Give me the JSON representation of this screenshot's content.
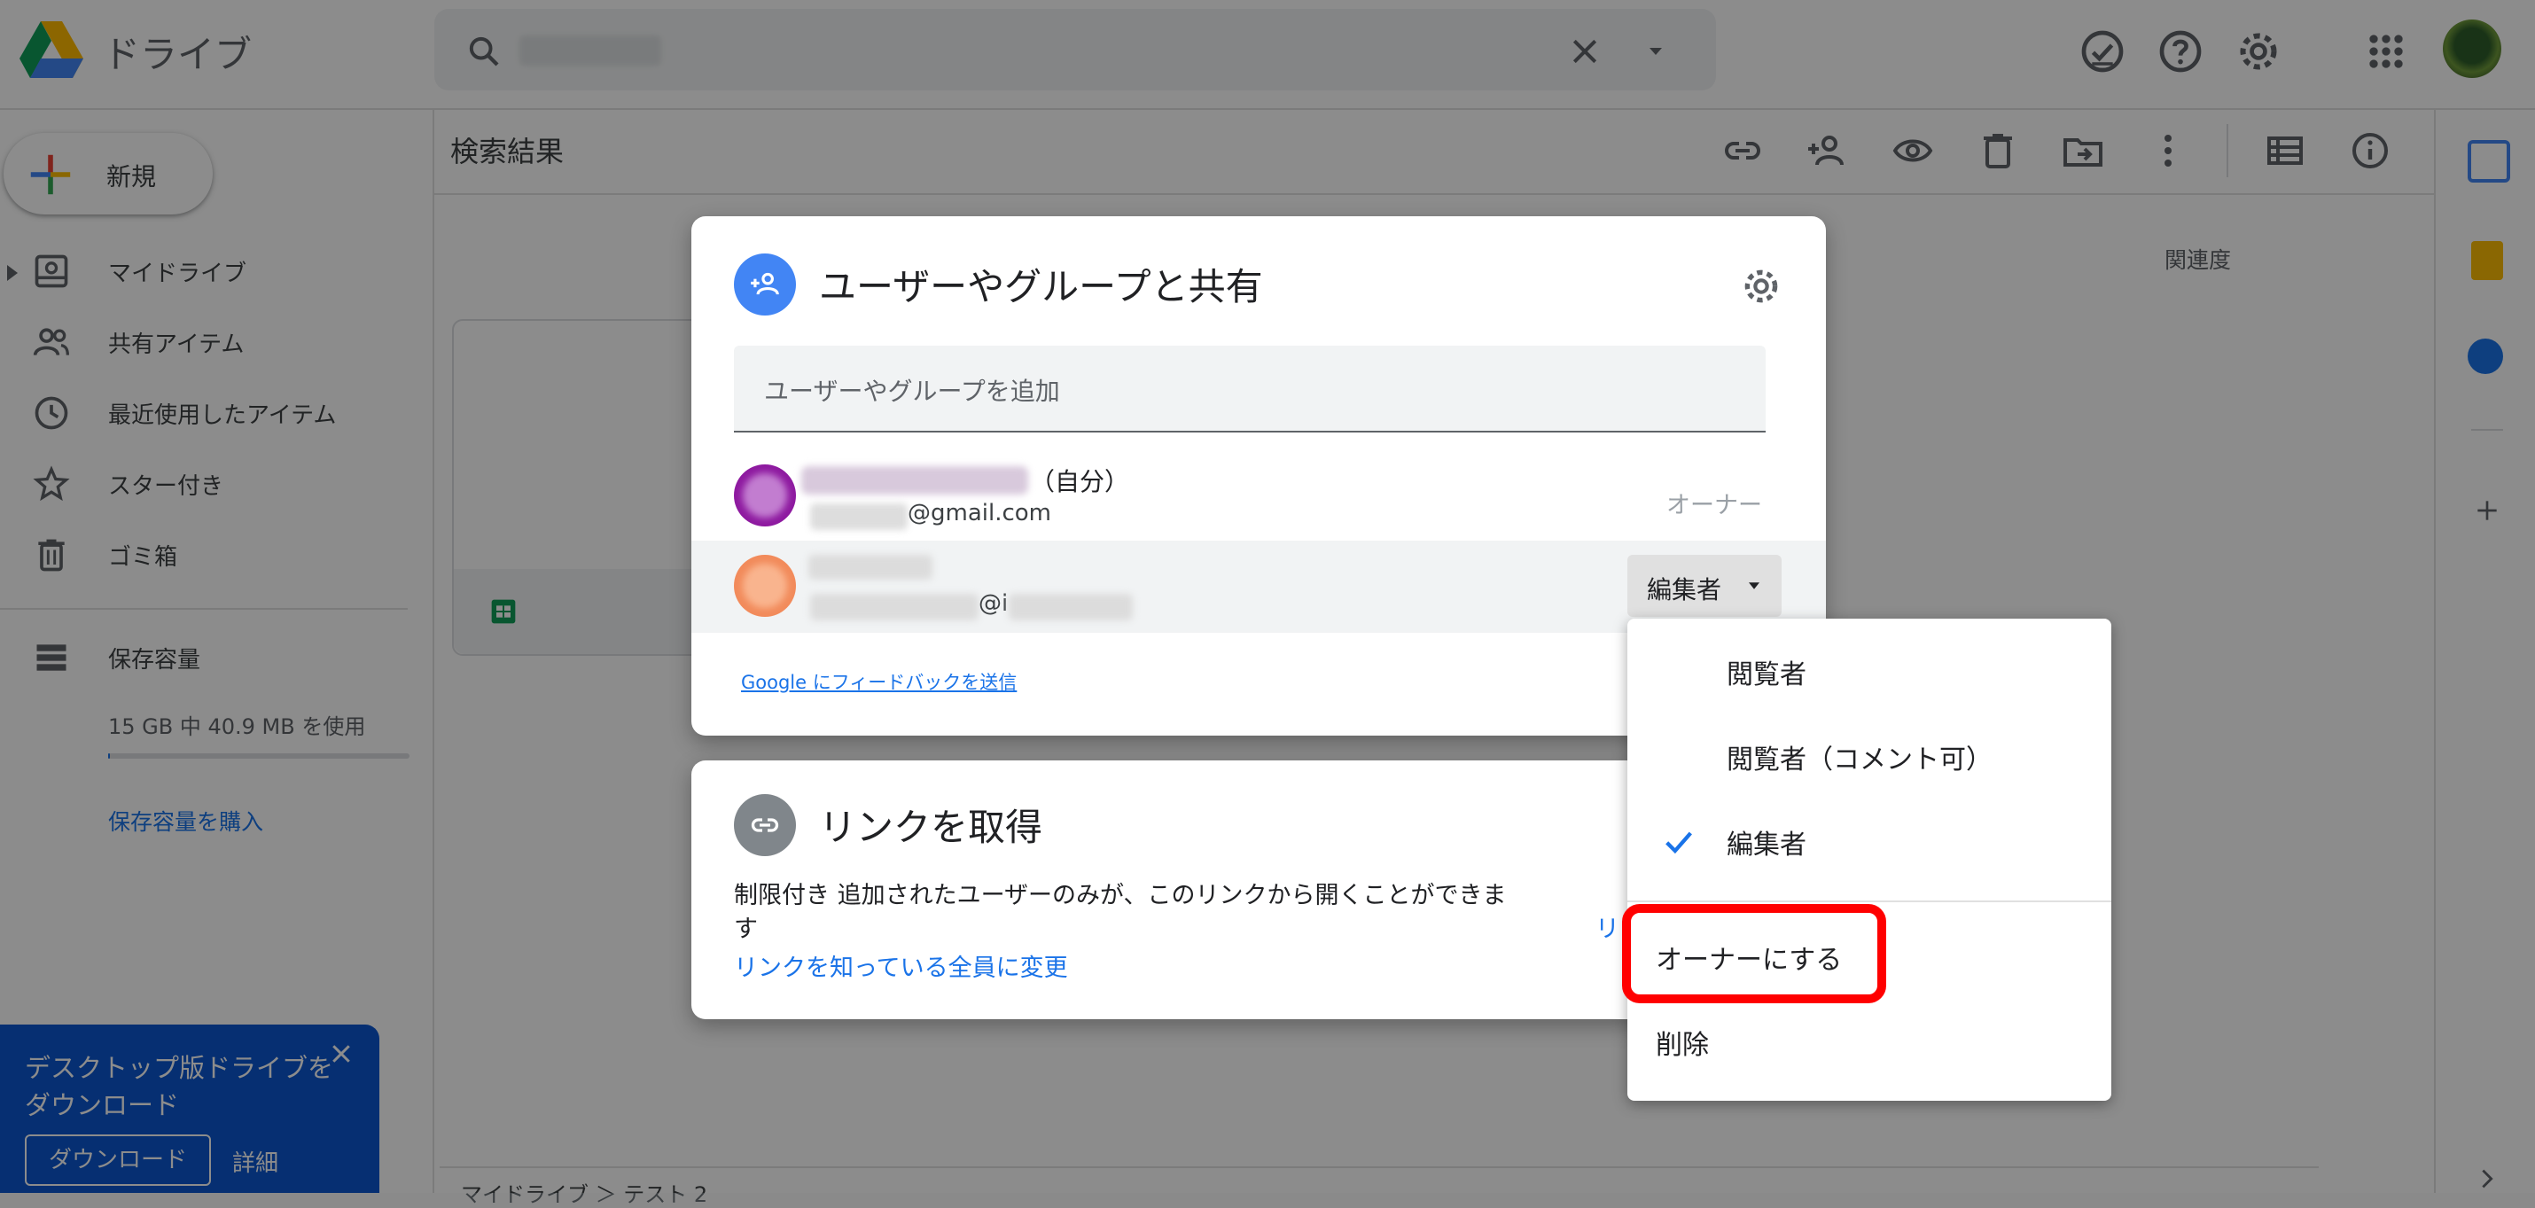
{
  "app": {
    "title": "ドライブ"
  },
  "header": {
    "search_icon": "search-icon",
    "clear_icon": "close-icon",
    "options_icon": "chevron-down-icon",
    "icons": [
      "offline-check-icon",
      "help-icon",
      "settings-icon",
      "apps-icon",
      "avatar"
    ]
  },
  "sidebar": {
    "new_label": "新規",
    "items": [
      {
        "label": "マイドライブ",
        "icon": "my-drive-icon"
      },
      {
        "label": "共有アイテム",
        "icon": "people-icon"
      },
      {
        "label": "最近使用したアイテム",
        "icon": "clock-icon"
      },
      {
        "label": "スター付き",
        "icon": "star-icon"
      },
      {
        "label": "ゴミ箱",
        "icon": "trash-icon"
      }
    ],
    "storage_label": "保存容量",
    "storage_used": "15 GB 中 40.9 MB を使用",
    "storage_fraction": 0.0027,
    "buy_storage": "保存容量を購入"
  },
  "main": {
    "title": "検索結果",
    "sort_label": "関連度",
    "footer_path": "マイドライブ ＞ テスト 2"
  },
  "promo": {
    "text_line1": "デスクトップ版ドライブを",
    "text_line2": "ダウンロード",
    "download_label": "ダウンロード",
    "details_label": "詳細"
  },
  "share_dialog": {
    "title": "ユーザーやグループと共有",
    "add_placeholder": "ユーザーやグループを追加",
    "owner_self_suffix": "（自分）",
    "owner_email_domain": "@gmail.com",
    "owner_role": "オーナー",
    "editor_email_prefix": "@i",
    "editor_role": "編集者",
    "feedback_link": "Google にフィードバックを送信"
  },
  "link_dialog": {
    "title": "リンクを取得",
    "restriction_bold": "制限付き",
    "restriction_text": "追加されたユーザーのみが、このリンクから開くことができま",
    "restriction_text2": "す",
    "change_link": "リンクを知っている全員に変更",
    "copy_link_partial": "リ"
  },
  "role_menu": {
    "items": [
      "閲覧者",
      "閲覧者（コメント可）",
      "編集者"
    ],
    "selected_index": 2,
    "make_owner": "オーナーにする",
    "remove": "削除"
  },
  "colors": {
    "accent_blue": "#1a73e8",
    "highlight_red": "#ff0000",
    "promo_blue": "#0b57d0"
  }
}
